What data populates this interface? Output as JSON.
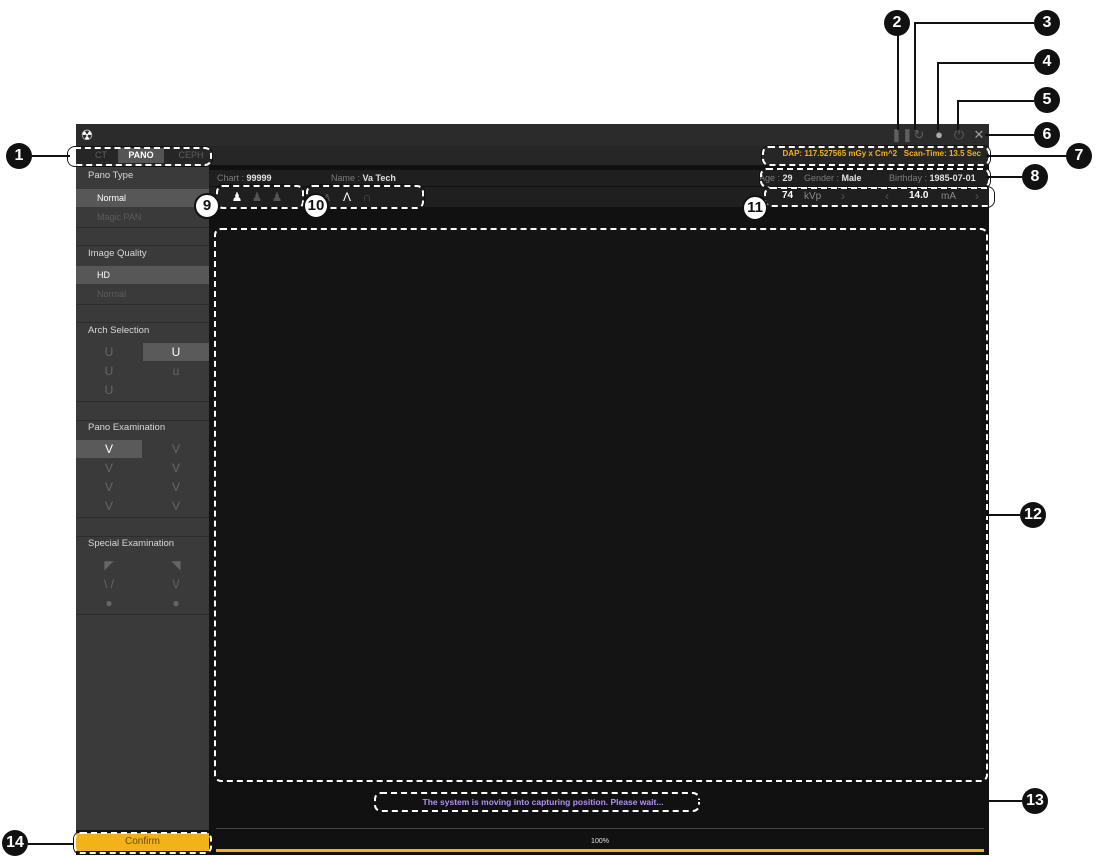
{
  "titlebar": {
    "logo_icon": "radiation-icon",
    "buttons": [
      {
        "name": "pause",
        "icon": "pause-icon"
      },
      {
        "name": "refresh",
        "icon": "refresh-icon"
      },
      {
        "name": "bulb",
        "icon": "bulb-icon"
      },
      {
        "name": "power",
        "icon": "power-icon"
      },
      {
        "name": "close",
        "icon": "close-icon",
        "glyph": "✕"
      }
    ]
  },
  "modes": {
    "tabs": [
      "CT",
      "PANO",
      "CEPH"
    ],
    "active": "PANO"
  },
  "scan_info": {
    "dap_label": "DAP:",
    "dap_value": "117.527565 mGy x Cm^2",
    "scan_time_label": "Scan-Time:",
    "scan_time_value": "13.5 Sec"
  },
  "patient": {
    "chart_label": "Chart :",
    "chart": "99999",
    "name_label": "Name :",
    "name": "Va Tech",
    "age_label": "Age :",
    "age": "29",
    "gender_label": "Gender :",
    "gender": "Male",
    "birthday_label": "Birthday :",
    "birthday": "1985-07-01"
  },
  "exposure": {
    "kvp": "74",
    "kvp_unit": "kVp",
    "ma": "14.0",
    "ma_unit": "mA"
  },
  "sidebar": {
    "pano_type": {
      "title": "Pano Type",
      "items": [
        "Normal",
        "Magic PAN"
      ],
      "active": "Normal"
    },
    "image_quality": {
      "title": "Image Quality",
      "items": [
        "HD",
        "Normal"
      ],
      "active": "HD"
    },
    "arch_selection": {
      "title": "Arch Selection"
    },
    "pano_examination": {
      "title": "Pano Examination"
    },
    "special_examination": {
      "title": "Special Examination"
    },
    "confirm_label": "Confirm"
  },
  "status": {
    "message": "The system is moving into capturing position. Please wait...",
    "progress_label": "100%",
    "progress": 1.0
  },
  "callouts": [
    "1",
    "2",
    "3",
    "4",
    "5",
    "6",
    "7",
    "8",
    "9",
    "10",
    "11",
    "12",
    "13",
    "14"
  ],
  "colors": {
    "accent": "#f2b21a",
    "status_text": "#b48ef8",
    "panel": "#3a3a3a",
    "background": "#111111"
  }
}
